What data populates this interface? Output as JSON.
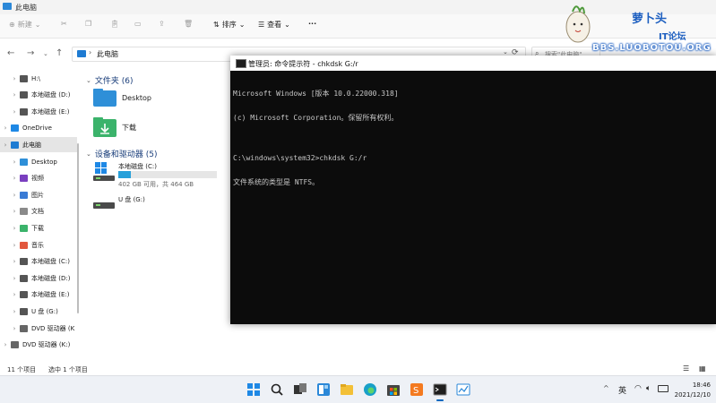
{
  "explorer": {
    "title": "此电脑",
    "toolbar": {
      "new": "新建",
      "sort": "排序",
      "view": "查看",
      "more": "···"
    },
    "address": {
      "crumb": "此电脑",
      "search_placeholder": "搜索\"此电脑\""
    }
  },
  "sidebar": {
    "items": [
      {
        "label": "H:\\",
        "icon": "drive-icon",
        "indent": 1
      },
      {
        "label": "本地磁盘 (D:)",
        "icon": "drive-icon",
        "indent": 1
      },
      {
        "label": "本地磁盘 (E:)",
        "icon": "drive-icon",
        "indent": 1
      },
      {
        "label": "OneDrive",
        "icon": "cloud-icon",
        "indent": 0
      },
      {
        "label": "此电脑",
        "icon": "pc-icon",
        "indent": 0,
        "selected": true
      },
      {
        "label": "Desktop",
        "icon": "desktop-icon",
        "indent": 1
      },
      {
        "label": "视频",
        "icon": "video-icon",
        "indent": 1
      },
      {
        "label": "图片",
        "icon": "pictures-icon",
        "indent": 1
      },
      {
        "label": "文档",
        "icon": "documents-icon",
        "indent": 1
      },
      {
        "label": "下载",
        "icon": "download-icon",
        "indent": 1
      },
      {
        "label": "音乐",
        "icon": "music-icon",
        "indent": 1
      },
      {
        "label": "本地磁盘 (C:)",
        "icon": "drive-icon",
        "indent": 1
      },
      {
        "label": "本地磁盘 (D:)",
        "icon": "drive-icon",
        "indent": 1
      },
      {
        "label": "本地磁盘 (E:)",
        "icon": "drive-icon",
        "indent": 1
      },
      {
        "label": "U 盘 (G:)",
        "icon": "drive-icon",
        "indent": 1
      },
      {
        "label": "DVD 驱动器 (K",
        "icon": "dvd-icon",
        "indent": 1
      },
      {
        "label": "DVD 驱动器 (K:)",
        "icon": "dvd-icon",
        "indent": 0
      }
    ]
  },
  "main": {
    "folders_header": "文件夹 (6)",
    "folders": [
      {
        "label": "Desktop",
        "icon": "desktop-folder-icon"
      },
      {
        "label": "下载",
        "icon": "download-folder-icon"
      }
    ],
    "drives_header": "设备和驱动器 (5)",
    "drives": [
      {
        "label": "本地磁盘 (C:)",
        "info": "402 GB 可用，共 464 GB",
        "used_fraction": 0.13
      },
      {
        "label": "U 盘 (G:)"
      }
    ]
  },
  "status": {
    "count": "11 个项目",
    "selected": "选中 1 个项目"
  },
  "cmd": {
    "title": "管理员: 命令提示符 - chkdsk  G:/r",
    "lines": [
      "Microsoft Windows [版本 10.0.22000.318]",
      "(c) Microsoft Corporation。保留所有权利。",
      "",
      "C:\\windows\\system32>chkdsk G:/r",
      "文件系统的类型是 NTFS。"
    ]
  },
  "taskbar": {
    "ime": "英",
    "up_arrow": "^",
    "time": "18:46",
    "date": "2021/12/10"
  },
  "watermark": {
    "line1": "萝卜头",
    "line2": "IT论坛",
    "line3": "BBS.LUOBOTOU.ORG"
  },
  "colors": {
    "accent": "#0067c0",
    "cmd_bg": "#0c0c0c",
    "cmd_text": "#c8c8c8",
    "drive_fill": "#26a0da"
  }
}
